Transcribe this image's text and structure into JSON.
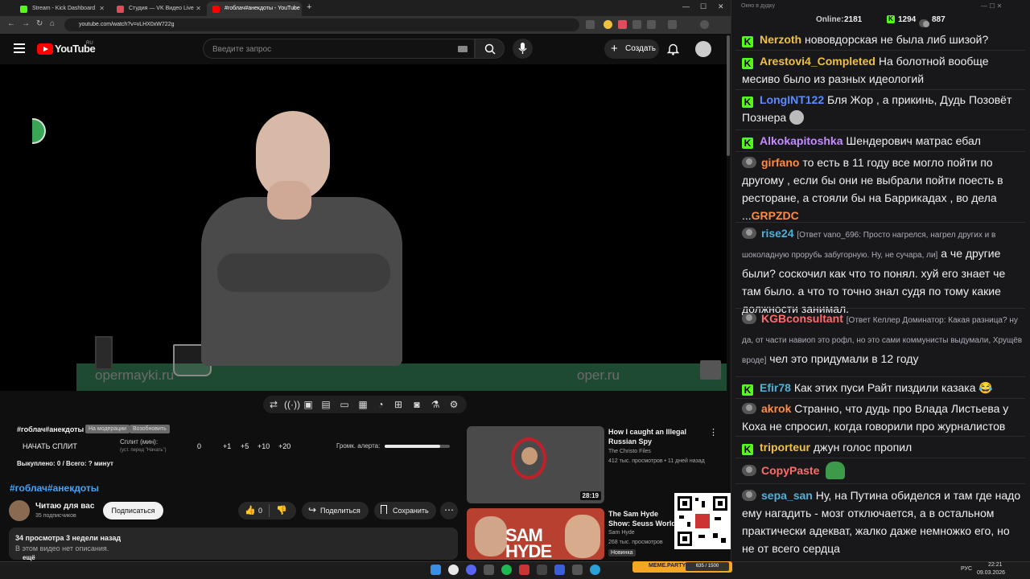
{
  "browser": {
    "tabs": [
      {
        "label": "Stream - Kick Dashboard",
        "color": "#53fc18"
      },
      {
        "label": "Студия — VK Видео Live",
        "color": "#e04c5c"
      },
      {
        "label": "#гоблач#анекдоты - YouTube",
        "color": "#ff0000"
      }
    ],
    "url": "youtube.com/watch?v=vLHX0xW722g"
  },
  "youtube": {
    "logo": "YouTube",
    "region": "RU",
    "search_placeholder": "Введите запрос",
    "create_label": "Создать",
    "video_watermark_left": "opermayki.ru",
    "video_watermark_right": "oper.ru"
  },
  "overlay": {
    "title_tag": "#гоблач#анекдоты",
    "badge1": "На модерации",
    "badge2": "Возобновить",
    "split_button": "НАЧАТЬ СПЛИТ",
    "split_label": "Сплит (мин):",
    "split_hint": "(уст. перед \"Начать\")",
    "split_values": [
      "0",
      "+1",
      "+5",
      "+10",
      "+20"
    ],
    "volume_label": "Громк. алерта:",
    "volume_level": 0.85,
    "bought": "Выкуплено: 0 / Всего: ? минут"
  },
  "video_info": {
    "title": "#гоблач#анекдоты",
    "channel": "Читаю для вас",
    "subscribers": "35 подписчиков",
    "subscribe_label": "Подписаться",
    "likes": "0",
    "share_label": "Поделиться",
    "save_label": "Сохранить",
    "stats": "34 просмотра  3 недели назад",
    "description": "В этом видео нет описания.",
    "more": "ещё"
  },
  "recommendations": [
    {
      "title": "How I caught an Illegal Russian Spy",
      "channel": "The Christo Files",
      "meta": "412 тыс. просмотров • 11 дней назад",
      "duration": "28:19"
    },
    {
      "title": "The Sam Hyde Show: Seuss World w/ Tyler",
      "channel": "Sam Hyde",
      "meta": "268 тыс. просмотров",
      "badge": "Новинка"
    }
  ],
  "chat": {
    "window_title": "Окно в дудку",
    "online_label": "Online:",
    "online_count": "2181",
    "kick_count": "1294",
    "vk_count": "887",
    "messages": [
      {
        "platform": "kick",
        "user": "Nerzoth",
        "color": "#f0c040",
        "text": "нововдорская не была либ шизой?"
      },
      {
        "platform": "kick",
        "user": "Arestovi4_Completed",
        "color": "#f0c040",
        "text": "На болотной вообще месиво было из разных идеологий"
      },
      {
        "platform": "kick",
        "user": "LongINT122",
        "color": "#5b8cff",
        "text": "Бля Жор , а прикинь, Дудь Позовёт Познера"
      },
      {
        "platform": "kick",
        "user": "Alkokapitoshka",
        "color": "#c58cff",
        "text": "Шендерович матрас ебал"
      },
      {
        "platform": "vk",
        "user": "girfano",
        "color": "#ff8c42",
        "text": "то есть в 11 году все могло пойти по другому , если бы они не выбрали пойти поесть в ресторане, а стояли бы на Баррикадах , во дела ...",
        "tail": "GRPZDC"
      },
      {
        "platform": "vk",
        "user": "rise24",
        "color": "#4fb0d8",
        "reply": "[Ответ vano_696: Просто нагрелся, нагрел других и в шоколадную прорубь забугорную. Ну, не сучара, ли]",
        "text": "а че другие были? соскочил как что то понял. хуй его знает че там было. а что то точно знал судя по тому какие должности занимал."
      },
      {
        "platform": "vk",
        "user": "KGBconsultant",
        "color": "#ff6b6b",
        "reply": "[Ответ Келлер Доминатор: Какая разница? ну да, от части навиоп это рофл, но это сами коммунисты выдумали, Хрущёв вроде]",
        "text": "чел это придумали в 12 году"
      },
      {
        "platform": "kick",
        "user": "Efir78",
        "color": "#4fb0d8",
        "text": "Как этих пуси Райт пиздили казака 😂"
      },
      {
        "platform": "vk",
        "user": "akrok",
        "color": "#ff8c42",
        "text": "Странно, что дудь про Влада Листьева у Коха не спросил, когда говорили про журналистов"
      },
      {
        "platform": "kick",
        "user": "triporteur",
        "color": "#f0c040",
        "text": "джун голос пропил"
      },
      {
        "platform": "vk",
        "user": "CopyPaste",
        "color": "#ff6b6b",
        "text": ""
      },
      {
        "platform": "vk",
        "user": "sepa_san",
        "color": "#4fb0d8",
        "text": "Ну, на Путина обиделся и там где надо ему нагадить - мозг отключается, а в остальном практически адекват, жалко даже немножко его, но не от всего сердца"
      }
    ]
  },
  "meme_widget": {
    "label": "MEME.PARTY",
    "count": "635 / 1500"
  },
  "taskbar": {
    "lang": "РУС",
    "time": "22:21",
    "date": "09.03.2026"
  }
}
